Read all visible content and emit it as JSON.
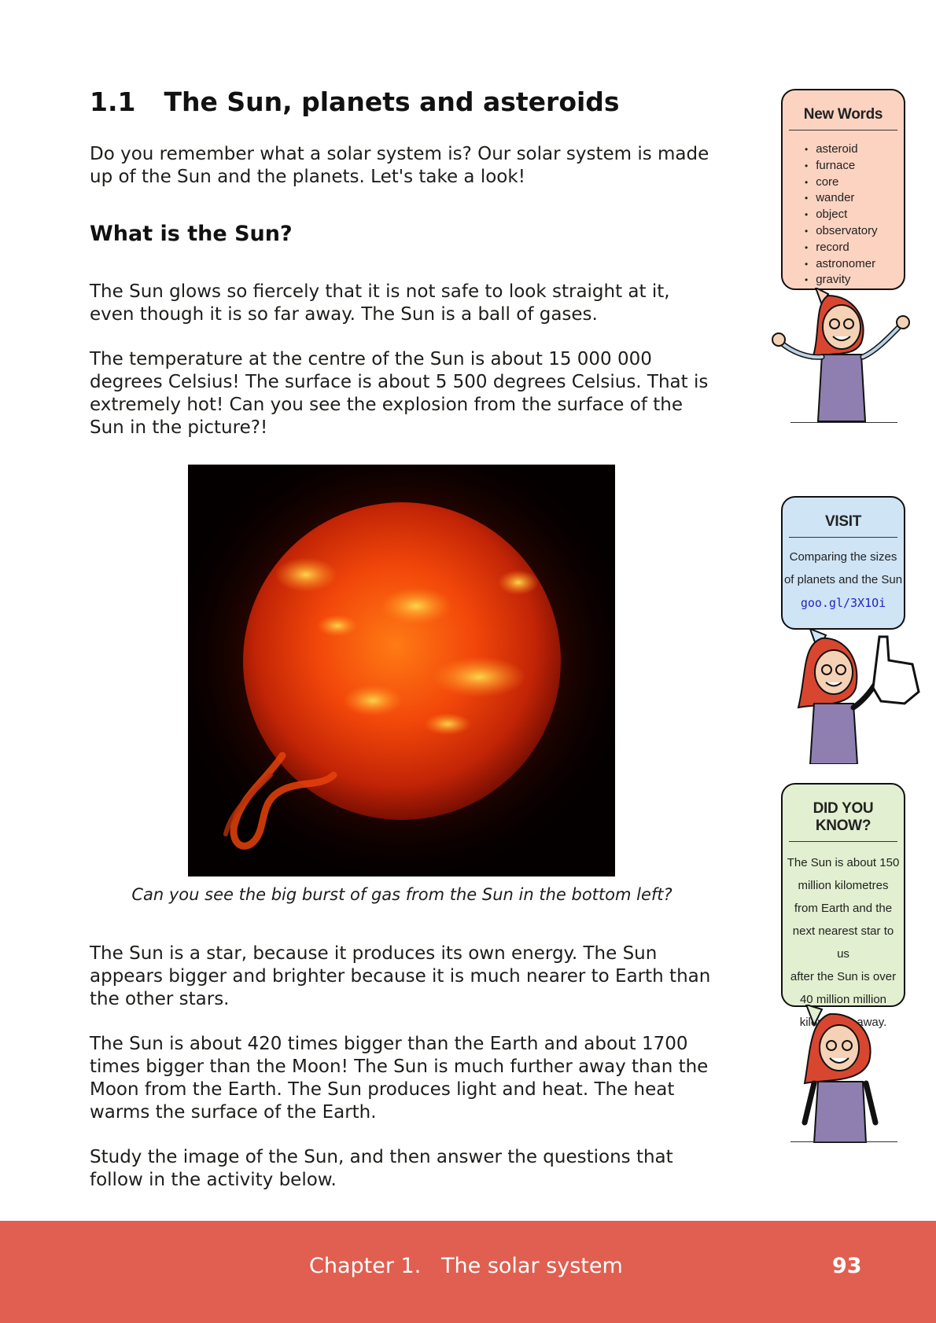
{
  "section": {
    "number": "1.1",
    "title": "The Sun, planets and asteroids"
  },
  "intro": "Do you remember what a solar system is? Our solar system is made up of the Sun and the planets. Let's take a look!",
  "subheading": "What is the Sun?",
  "paragraphs": {
    "p1": "The Sun glows so fiercely that it is not safe to look straight at it, even though it is so far away. The Sun is a ball of gases.",
    "p2": "The temperature at the centre of the Sun is about 15 000 000 degrees Celsius! The surface is about 5 500 degrees Celsius. That is extremely hot! Can you see the explosion from the surface of the Sun in the picture?!",
    "p3": "The Sun is a star, because it produces its own energy. The Sun appears bigger and brighter because it is much nearer to Earth than the other stars.",
    "p4": "The Sun is about 420 times bigger than the Earth and about 1700 times bigger than the Moon! The Sun is much further away than the Moon from the Earth. The Sun produces light and heat. The heat warms the surface of the Earth.",
    "p5": "Study the image of the Sun, and then answer the questions that follow in the activity below."
  },
  "figure": {
    "caption": "Can you see the big burst of gas from the Sun in the bottom left?"
  },
  "new_words": {
    "title": "New Words",
    "items": [
      "asteroid",
      "furnace",
      "core",
      "wander",
      "object",
      "observatory",
      "record",
      "astronomer",
      "gravity"
    ]
  },
  "visit": {
    "title": "VISIT",
    "line1": "Comparing the sizes",
    "line2": "of planets and the Sun",
    "link": "goo.gl/3X1Oi"
  },
  "did_you_know": {
    "title": "DID YOU KNOW?",
    "lines": [
      "The Sun is about 150",
      "million kilometres",
      "from Earth and the",
      "next nearest star to us",
      "after the Sun is over",
      "40 million million",
      "kilometres away."
    ]
  },
  "footer": {
    "chapter": "Chapter 1.   The solar system",
    "page": "93",
    "color": "#e05f51"
  },
  "colors": {
    "new_words_bg": "#fcd3c1",
    "visit_bg": "#cfe4f5",
    "know_bg": "#e2efd0",
    "link": "#2323c8"
  }
}
